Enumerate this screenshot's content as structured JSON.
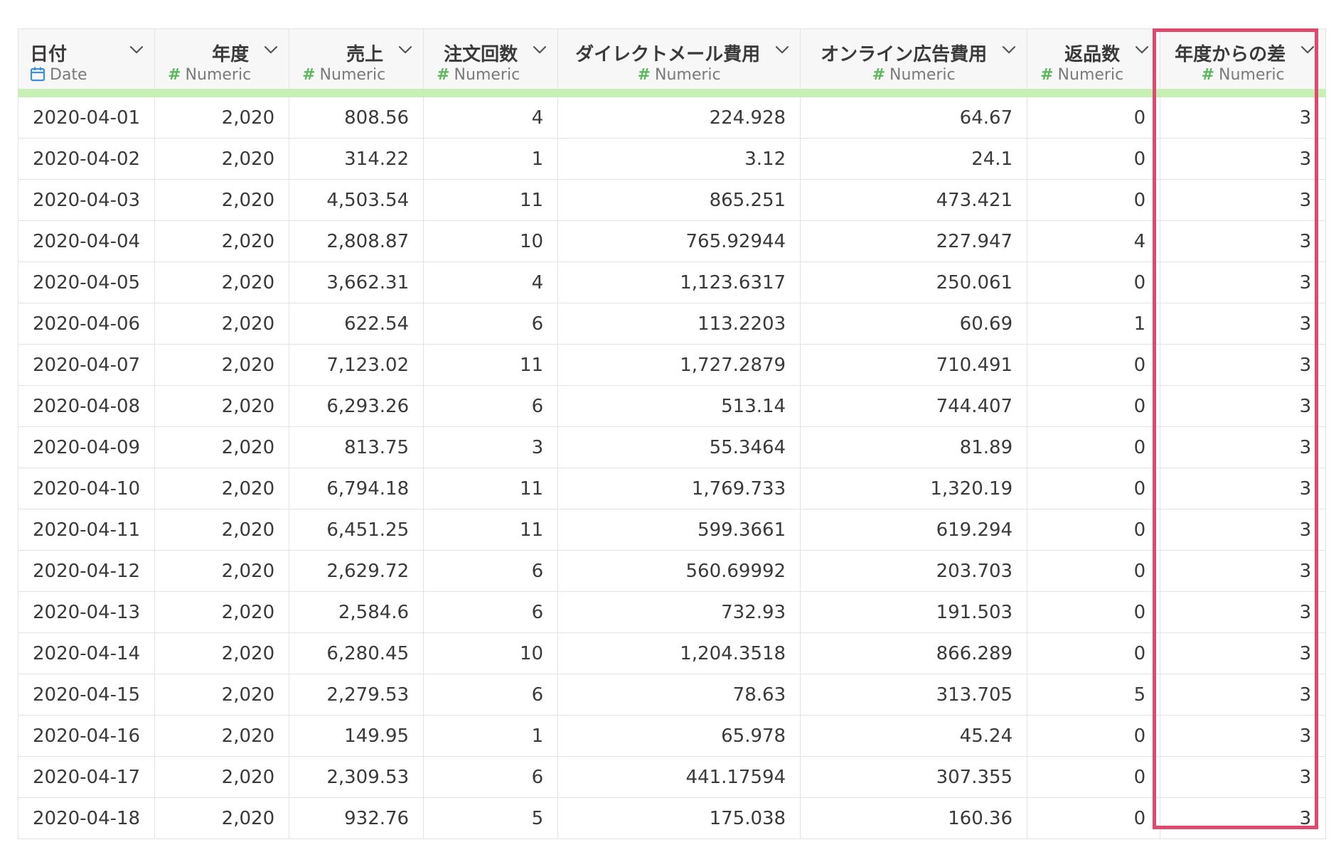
{
  "highlight_color": "#e0486f",
  "header_accent_color": "#c6f0b6",
  "columns": [
    {
      "name": "日付",
      "type_icon": "calendar-icon",
      "type": "Date"
    },
    {
      "name": "年度",
      "type_icon": "hash-icon",
      "type": "Numeric"
    },
    {
      "name": "売上",
      "type_icon": "hash-icon",
      "type": "Numeric"
    },
    {
      "name": "注文回数",
      "type_icon": "hash-icon",
      "type": "Numeric"
    },
    {
      "name": "ダイレクトメール費用",
      "type_icon": "hash-icon",
      "type": "Numeric"
    },
    {
      "name": "オンライン広告費用",
      "type_icon": "hash-icon",
      "type": "Numeric"
    },
    {
      "name": "返品数",
      "type_icon": "hash-icon",
      "type": "Numeric"
    },
    {
      "name": "年度からの差",
      "type_icon": "hash-icon",
      "type": "Numeric"
    }
  ],
  "rows": [
    [
      "2020-04-01",
      "2,020",
      "808.56",
      "4",
      "224.928",
      "64.67",
      "0",
      "3"
    ],
    [
      "2020-04-02",
      "2,020",
      "314.22",
      "1",
      "3.12",
      "24.1",
      "0",
      "3"
    ],
    [
      "2020-04-03",
      "2,020",
      "4,503.54",
      "11",
      "865.251",
      "473.421",
      "0",
      "3"
    ],
    [
      "2020-04-04",
      "2,020",
      "2,808.87",
      "10",
      "765.92944",
      "227.947",
      "4",
      "3"
    ],
    [
      "2020-04-05",
      "2,020",
      "3,662.31",
      "4",
      "1,123.6317",
      "250.061",
      "0",
      "3"
    ],
    [
      "2020-04-06",
      "2,020",
      "622.54",
      "6",
      "113.2203",
      "60.69",
      "1",
      "3"
    ],
    [
      "2020-04-07",
      "2,020",
      "7,123.02",
      "11",
      "1,727.2879",
      "710.491",
      "0",
      "3"
    ],
    [
      "2020-04-08",
      "2,020",
      "6,293.26",
      "6",
      "513.14",
      "744.407",
      "0",
      "3"
    ],
    [
      "2020-04-09",
      "2,020",
      "813.75",
      "3",
      "55.3464",
      "81.89",
      "0",
      "3"
    ],
    [
      "2020-04-10",
      "2,020",
      "6,794.18",
      "11",
      "1,769.733",
      "1,320.19",
      "0",
      "3"
    ],
    [
      "2020-04-11",
      "2,020",
      "6,451.25",
      "11",
      "599.3661",
      "619.294",
      "0",
      "3"
    ],
    [
      "2020-04-12",
      "2,020",
      "2,629.72",
      "6",
      "560.69992",
      "203.703",
      "0",
      "3"
    ],
    [
      "2020-04-13",
      "2,020",
      "2,584.6",
      "6",
      "732.93",
      "191.503",
      "0",
      "3"
    ],
    [
      "2020-04-14",
      "2,020",
      "6,280.45",
      "10",
      "1,204.3518",
      "866.289",
      "0",
      "3"
    ],
    [
      "2020-04-15",
      "2,020",
      "2,279.53",
      "6",
      "78.63",
      "313.705",
      "5",
      "3"
    ],
    [
      "2020-04-16",
      "2,020",
      "149.95",
      "1",
      "65.978",
      "45.24",
      "0",
      "3"
    ],
    [
      "2020-04-17",
      "2,020",
      "2,309.53",
      "6",
      "441.17594",
      "307.355",
      "0",
      "3"
    ],
    [
      "2020-04-18",
      "2,020",
      "932.76",
      "5",
      "175.038",
      "160.36",
      "0",
      "3"
    ]
  ]
}
